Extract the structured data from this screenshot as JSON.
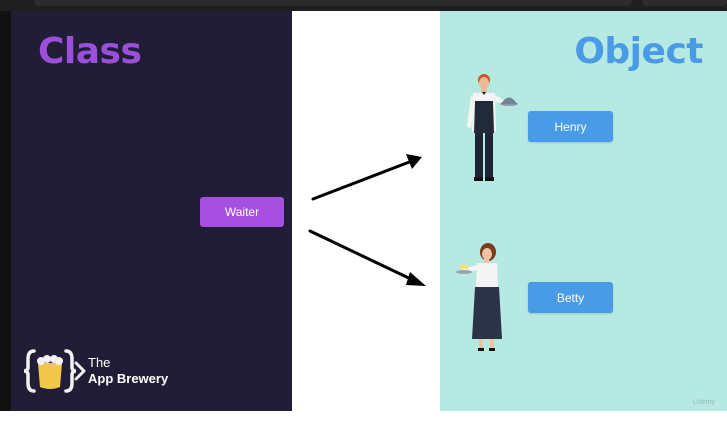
{
  "titles": {
    "class": "Class",
    "object": "Object"
  },
  "buttons": {
    "waiter": "Waiter",
    "henry": "Henry",
    "betty": "Betty"
  },
  "logo": {
    "line1": "The",
    "line2": "App Brewery"
  },
  "watermark": "Udemy",
  "colors": {
    "left_panel": "#221d37",
    "right_panel": "#b7e9e3",
    "class_title": "#9b4fdb",
    "object_title": "#4a9be6",
    "waiter_button": "#a64fe0",
    "object_buttons": "#4a9be6"
  },
  "icons": [
    "arrow-to-henry-icon",
    "arrow-to-betty-icon",
    "app-brewery-logo-icon",
    "waiter-figure-icon",
    "waitress-figure-icon"
  ]
}
